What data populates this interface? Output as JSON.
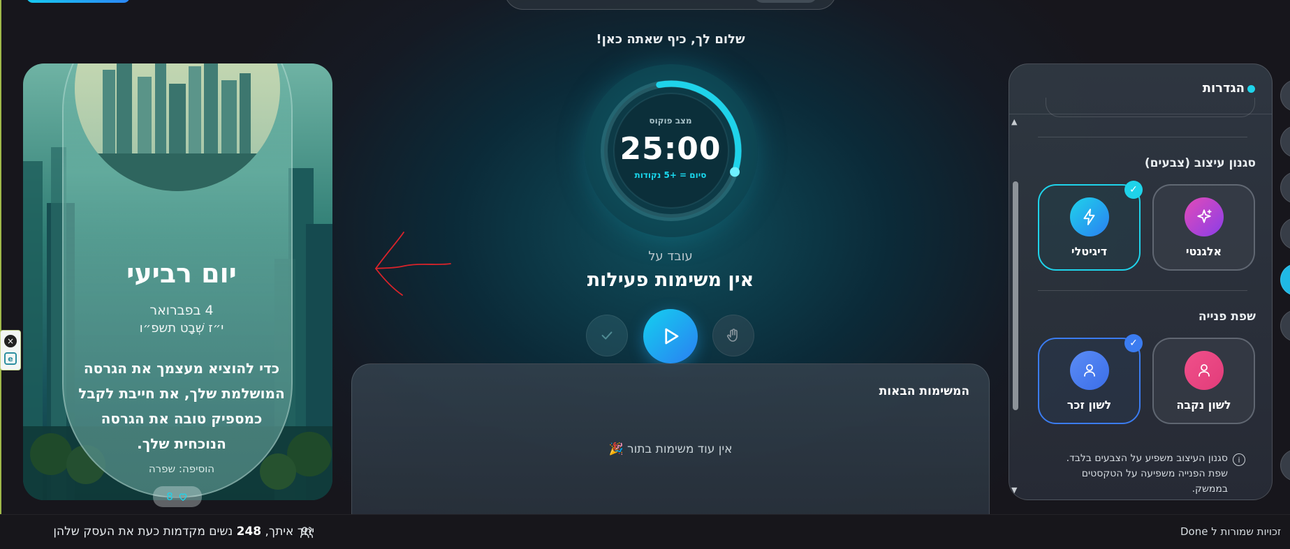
{
  "header": {
    "greeting": "שלום לך, כיף שאתה כאן!"
  },
  "timer": {
    "mode_label": "מצב פוקוס",
    "time": "25:00",
    "bonus": "סיום = +5 נקודות",
    "progress": 0.33,
    "accent": "#1fd3ea"
  },
  "current_task": {
    "label": "עובד על",
    "value": "אין משימות פעילות"
  },
  "controls": {
    "complete_icon": "check-icon",
    "play_icon": "play-icon",
    "pause_icon": "hand-icon"
  },
  "next_tasks": {
    "title": "המשימות הבאות",
    "empty_text": "אין עוד משימות בתור 🎉"
  },
  "day_card": {
    "day_name": "יום רביעי",
    "gregorian_date": "4 בפברואר",
    "hebrew_date": "י״ז שְׁבָט תשפ״ו",
    "quote": "כדי להוציא מעצמך את הגרסה המושלמת שלך, את חייבת לקבל כמספיק טובה את הגרסה הנוכחית שלך.",
    "author": "הוסיפה: שפרה",
    "likes": "8"
  },
  "settings": {
    "title": "הגדרות",
    "style_section": {
      "title": "סגנון עיצוב (צבעים)",
      "options": [
        {
          "label": "אלגנטי",
          "icon": "sparkles-icon",
          "selected": false,
          "color": "#c23fd6"
        },
        {
          "label": "דיגיטלי",
          "icon": "lightning-icon",
          "selected": true,
          "color": "#1fd3ea"
        }
      ]
    },
    "address_section": {
      "title": "שפת פנייה",
      "options": [
        {
          "label": "לשון נקבה",
          "icon": "user-icon",
          "selected": false,
          "color": "#f0508a"
        },
        {
          "label": "לשון זכר",
          "icon": "user-icon",
          "selected": true,
          "color": "#3b7cf0"
        }
      ]
    },
    "info": "סגנון העיצוב משפיע על הצבעים בלבד. שפת הפנייה משפיעה על הטקסטים בממשק."
  },
  "footer": {
    "community_prefix": "יחד איתך,",
    "community_count": "248",
    "community_suffix": "נשים מקדמות כעת את העסק שלהן",
    "right_text": "זכויות שמורות ל Done"
  }
}
